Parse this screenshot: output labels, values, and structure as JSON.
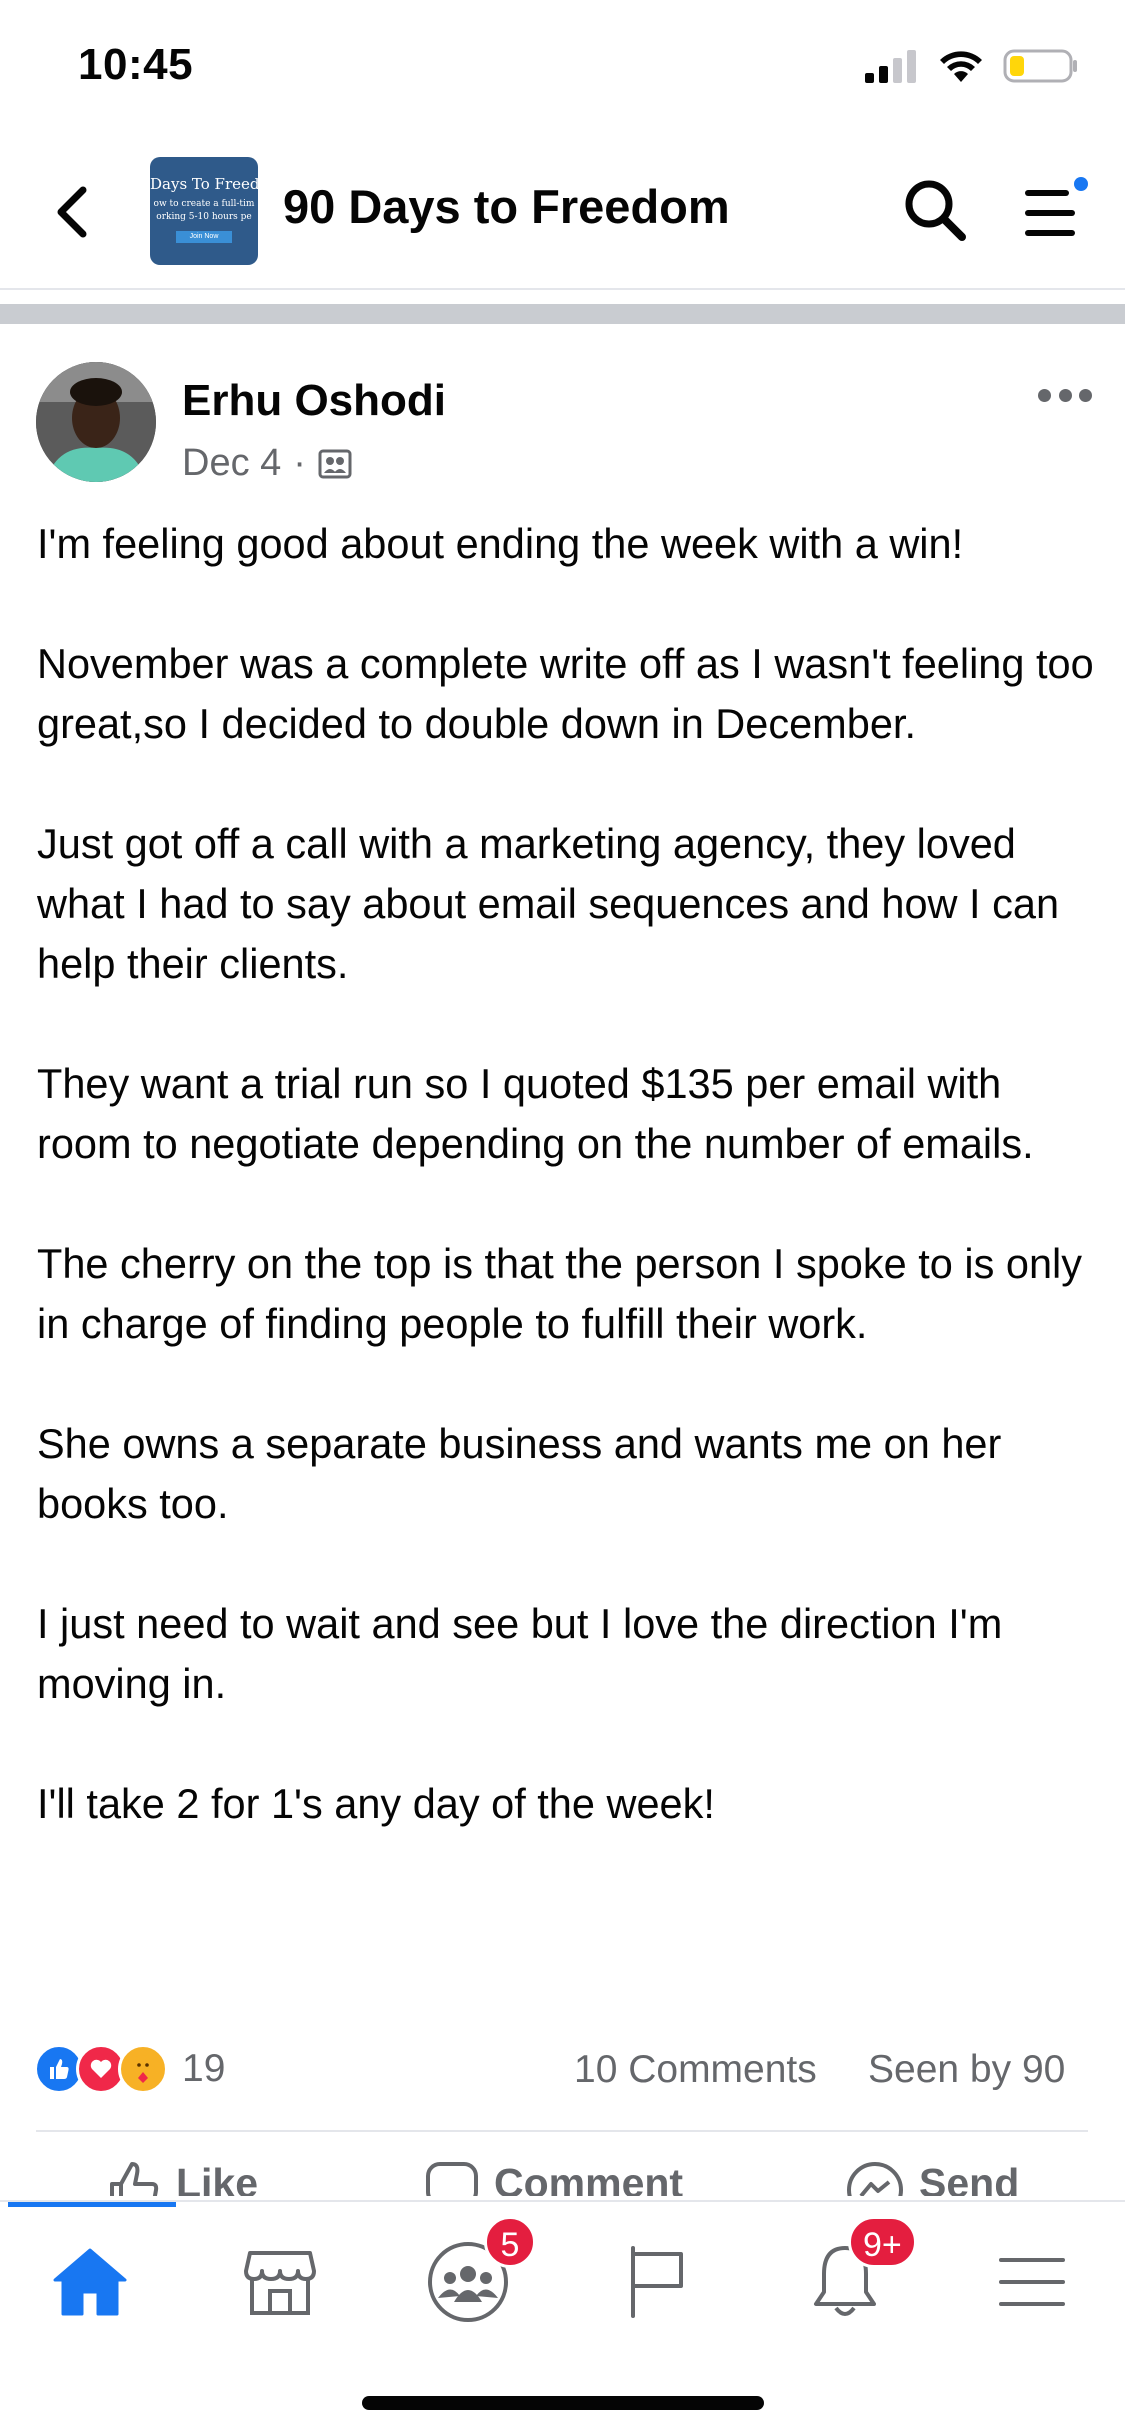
{
  "status_bar": {
    "time": "10:45",
    "icons": [
      "signal-icon",
      "wifi-icon",
      "battery-icon"
    ]
  },
  "header": {
    "group_name": "90 Days to Freedom",
    "thumbnail": {
      "line1": "Days To Freedom",
      "line2": "ow to create a full-tim",
      "line3": "orking 5-10 hours pe",
      "button": "Join Now"
    },
    "icons": [
      "back-icon",
      "search-icon",
      "menu-icon"
    ]
  },
  "post": {
    "author": "Erhu Oshodi",
    "date": "Dec 4",
    "separator": "·",
    "paragraphs": [
      "I'm feeling good about ending the week with a win!",
      "November was a complete write off as I wasn't feeling too great,so I decided to double down in December.",
      "Just got off a call with a marketing agency, they loved what I had to say about email sequences and how I can help their clients.",
      "They want a trial run so I quoted $135 per email with room to negotiate depending on the number of emails.",
      "The cherry on the top is that the person I spoke to is only in charge of finding people to fulfill their work.",
      "She owns a separate business and wants me on her books too.",
      "I just need to wait and see but I love the direction I'm moving in.",
      "I'll take 2 for 1's any day of the week!"
    ],
    "reaction_count": "19",
    "comments": "10 Comments",
    "seen_by": "Seen by 90",
    "actions": {
      "like": "Like",
      "comment": "Comment",
      "send": "Send"
    }
  },
  "tab_bar": {
    "tabs": [
      "home",
      "marketplace",
      "groups",
      "pages",
      "notifications",
      "menu"
    ],
    "active": "home",
    "groups_badge": "5",
    "notifications_badge": "9+"
  },
  "colors": {
    "accent": "#1877f2",
    "text": "#050505",
    "secondary_text": "#65676b",
    "badge": "#e41e3f"
  }
}
